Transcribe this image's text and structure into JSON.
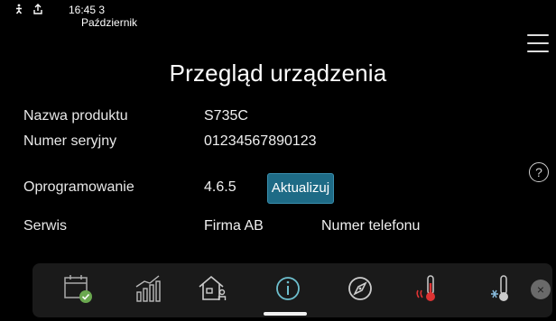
{
  "status": {
    "time_line": "16:45 3",
    "month": "Październik",
    "icons": [
      "person-icon",
      "upload-icon"
    ]
  },
  "menu": {
    "icon": "hamburger-menu-icon"
  },
  "title": "Przegląd urządzenia",
  "info": {
    "product_name_label": "Nazwa produktu",
    "product_name_value": "S735C",
    "serial_label": "Numer seryjny",
    "serial_value": "01234567890123",
    "software_label": "Oprogramowanie",
    "software_value": "4.6.5",
    "update_button": "Aktualizuj",
    "service_label": "Serwis",
    "service_value": "Firma AB",
    "phone_label": "Numer telefonu"
  },
  "help": {
    "glyph": "?"
  },
  "dock": {
    "items": [
      {
        "name": "calendar-icon"
      },
      {
        "name": "statistics-icon"
      },
      {
        "name": "home-icon"
      },
      {
        "name": "info-icon",
        "active": true
      },
      {
        "name": "compass-icon"
      },
      {
        "name": "hot-water-temperature-icon"
      },
      {
        "name": "cooling-temperature-icon"
      }
    ],
    "close_glyph": "×",
    "accent_color": "#1e6b86"
  }
}
